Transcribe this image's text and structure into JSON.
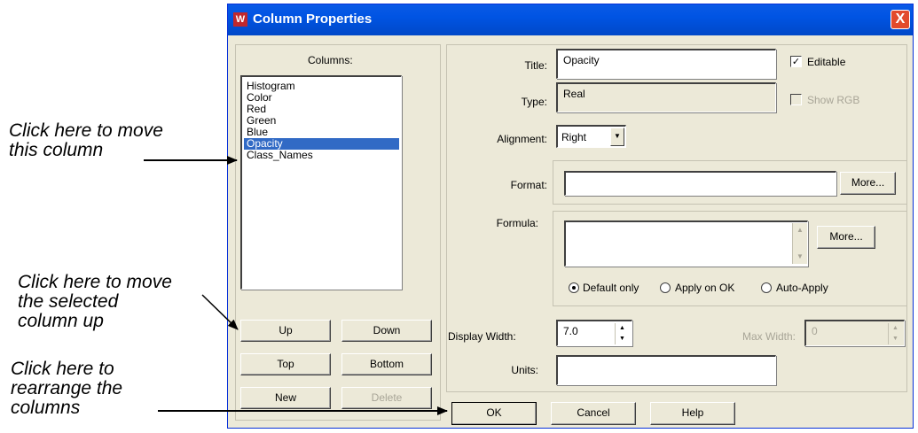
{
  "annotations": {
    "move_column": [
      "Click here to move",
      "this column"
    ],
    "move_up": [
      "Click here to move",
      "the selected",
      "column up"
    ],
    "rearrange": [
      "Click here to",
      "rearrange the",
      "columns"
    ]
  },
  "dialog": {
    "title": "Column Properties",
    "app_icon": "W",
    "close_label": "X"
  },
  "columns": {
    "label": "Columns:",
    "items": [
      "Histogram",
      "Color",
      "Red",
      "Green",
      "Blue",
      "Opacity",
      "Class_Names"
    ],
    "selected": "Opacity",
    "buttons": {
      "up": "Up",
      "down": "Down",
      "top": "Top",
      "bottom": "Bottom",
      "new": "New",
      "delete": "Delete"
    }
  },
  "properties": {
    "title_label": "Title:",
    "title_value": "Opacity",
    "editable_label": "Editable",
    "editable_checked": true,
    "type_label": "Type:",
    "type_value": "Real",
    "show_rgb_label": "Show RGB",
    "show_rgb_checked": false,
    "alignment_label": "Alignment:",
    "alignment_value": "Right",
    "format_label": "Format:",
    "format_value": "",
    "format_more": "More...",
    "formula_label": "Formula:",
    "formula_value": "",
    "formula_more": "More...",
    "radio_default": "Default only",
    "radio_apply": "Apply on OK",
    "radio_auto": "Auto-Apply",
    "radio_selected": "Default only",
    "display_width_label": "Display Width:",
    "display_width_value": "7.0",
    "max_width_label": "Max Width:",
    "max_width_value": "0",
    "units_label": "Units:",
    "units_value": ""
  },
  "footer": {
    "ok": "OK",
    "cancel": "Cancel",
    "help": "Help"
  },
  "icons": {
    "check": "check-icon",
    "up_arrow": "spin-up-icon",
    "down_arrow": "spin-down-icon",
    "combo_arrow": "chevron-down-icon"
  },
  "colors": {
    "titlebar": "#0054e3",
    "dialog_bg": "#ece9d8",
    "selection": "#316ac5",
    "close": "#e24a2c"
  }
}
